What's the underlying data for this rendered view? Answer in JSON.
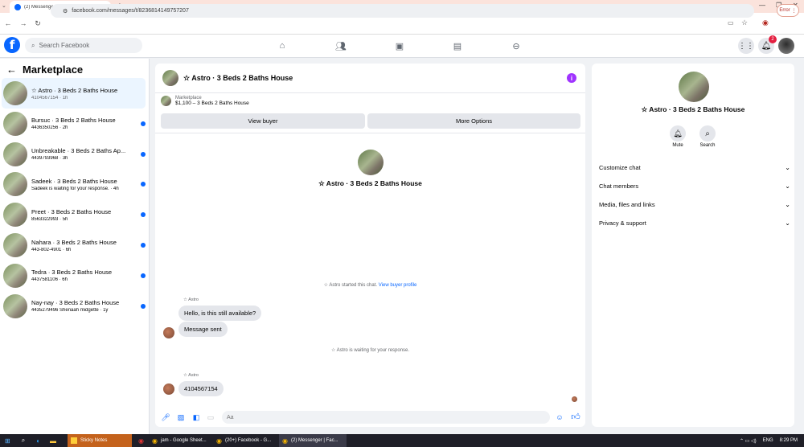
{
  "browser": {
    "tab_title": "(2) Messenger | Facebook",
    "url": "facebook.com/messages/t/8236814149757207",
    "error_label": "Error"
  },
  "fb": {
    "search_placeholder": "Search Facebook",
    "notification_count": "2",
    "brand_color": "#0866ff"
  },
  "sidebar": {
    "title": "Marketplace",
    "items": [
      {
        "title": "☆ Astro · 3 Beds 2 Baths House",
        "sub": "4104567154 · 1h",
        "unread": false,
        "active": true
      },
      {
        "title": "Bursuc · 3 Beds 2 Baths House",
        "sub": "4436350256 · 2h",
        "unread": true,
        "active": false
      },
      {
        "title": "Unbreakable · 3 Beds 2 Baths Ap...",
        "sub": "4439793968 · 3h",
        "unread": true,
        "active": false
      },
      {
        "title": "Sadeek · 3 Beds 2 Baths House",
        "sub": "Sadeek is waiting for your response. · 4h",
        "unread": true,
        "active": false
      },
      {
        "title": "Preet · 3 Beds 2 Baths House",
        "sub": "8563322993 · 5h",
        "unread": true,
        "active": false
      },
      {
        "title": "Nahara · 3 Beds 2 Baths House",
        "sub": "443-802-4901 · 6h",
        "unread": true,
        "active": false
      },
      {
        "title": "Tedra · 3 Beds 2 Baths House",
        "sub": "4437581106 · 6h",
        "unread": true,
        "active": false
      },
      {
        "title": "Nay-nay · 3 Beds 2 Baths House",
        "sub": "4435279496 Shenaah midgette · 1y",
        "unread": true,
        "active": false
      }
    ]
  },
  "chat": {
    "title": "☆ Astro · 3 Beds 2 Baths House",
    "listing_source": "Marketplace",
    "listing_price": "$1,100 – 3 Beds 2 Baths House",
    "view_buyer": "View buyer",
    "more_options": "More Options",
    "center_title": "☆ Astro · 3 Beds 2 Baths House",
    "started_text": "☆ Astro started this chat.",
    "view_profile_link": "View buyer profile",
    "sender1": "☆ Astro",
    "msg1": "Hello, is this still available?",
    "msg2": "Message sent",
    "waiting_text": "☆ Astro is waiting for your response.",
    "sender2": "☆ Astro",
    "msg3": "4104567154",
    "composer_placeholder": "Aa"
  },
  "rpanel": {
    "title": "☆ Astro · 3 Beds 2 Baths House",
    "mute": "Mute",
    "search": "Search",
    "rows": [
      "Customize chat",
      "Chat members",
      "Media, files and links",
      "Privacy & support"
    ]
  },
  "taskbar": {
    "apps": [
      "Sticky Notes",
      "jam - Google Sheet...",
      "(20+) Facebook - G...",
      "(2) Messenger | Fac..."
    ],
    "lang": "ENG",
    "time": "8:29 PM"
  }
}
